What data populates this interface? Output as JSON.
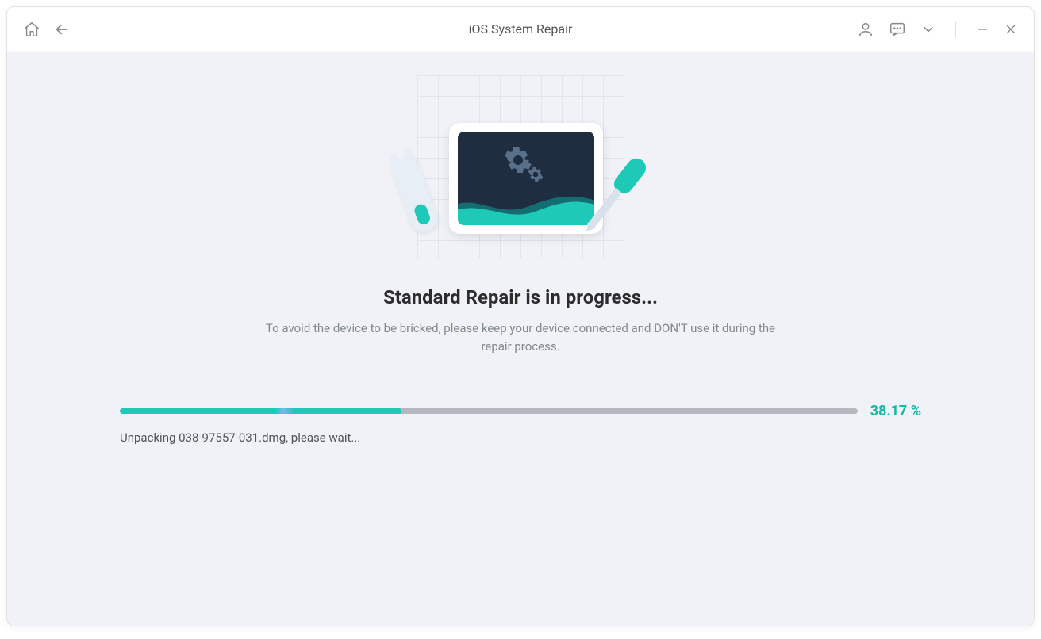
{
  "titlebar": {
    "title": "iOS System Repair"
  },
  "main": {
    "heading": "Standard Repair is in progress...",
    "subtext": "To avoid the device to be bricked, please keep your device connected and DON'T use it during the repair process."
  },
  "progress": {
    "percent_value": 38.17,
    "percent_label": "38.17 %",
    "fill_width_style": "width:38.17%",
    "status_text": "Unpacking 038-97557-031.dmg, please wait..."
  },
  "colors": {
    "accent": "#1ec9b7",
    "dark_panel": "#1e2d40",
    "page_bg": "#f0f2f7"
  }
}
